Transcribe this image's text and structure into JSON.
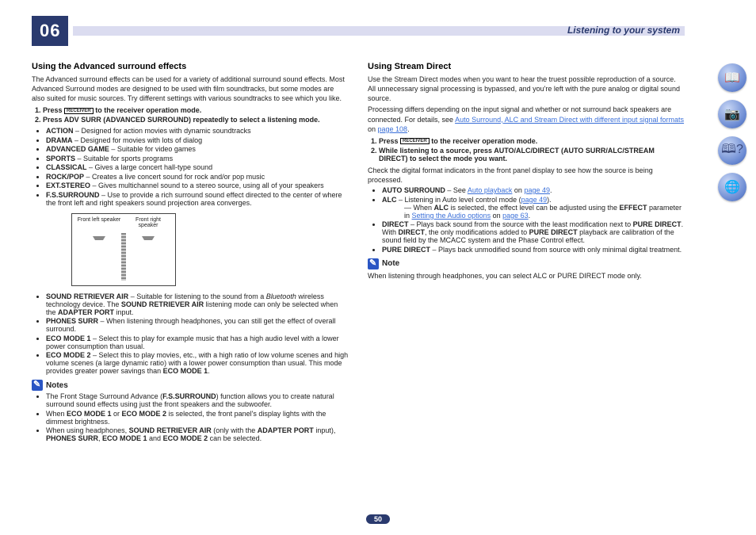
{
  "chapter": "06",
  "header_title": "Listening to your system",
  "page_number": "50",
  "left": {
    "h": "Using the Advanced surround effects",
    "intro": "The Advanced surround effects can be used for a variety of additional surround sound effects. Most Advanced Surround modes are designed to be used with film soundtracks, but some modes are also suited for music sources. Try different settings with various soundtracks to see which you like.",
    "step1_a": "Press ",
    "step1_b": " to the receiver operation mode.",
    "step2": "Press ADV SURR (ADVANCED SURROUND) repeatedly to select a listening mode.",
    "modes": [
      {
        "b": "ACTION",
        "d": " – Designed for action movies with dynamic soundtracks"
      },
      {
        "b": "DRAMA",
        "d": " – Designed for movies with lots of dialog"
      },
      {
        "b": "ADVANCED GAME",
        "d": " – Suitable for video games"
      },
      {
        "b": "SPORTS",
        "d": " – Suitable for sports programs"
      },
      {
        "b": "CLASSICAL",
        "d": " – Gives a large concert hall-type sound"
      },
      {
        "b": "ROCK/POP",
        "d": " – Creates a live concert sound for rock and/or pop music"
      },
      {
        "b": "EXT.STEREO",
        "d": " – Gives multichannel sound to a stereo source, using all of your speakers"
      },
      {
        "b": "F.S.SURROUND",
        "d": " – Use to provide a rich surround sound effect directed to the center of where the front left and right speakers sound projection area converges."
      }
    ],
    "diagram": {
      "l": "Front left speaker",
      "r": "Front right speaker"
    },
    "modes2": {
      "sr": {
        "b": "SOUND RETRIEVER AIR",
        "d1": " – Suitable for listening to the sound from a ",
        "i": "Bluetooth",
        "d2": " wireless technology device. The ",
        "b2": "SOUND RETRIEVER AIR",
        "d3": " listening mode can only be selected when the ",
        "b3": "ADAPTER PORT",
        "d4": " input."
      },
      "ph": {
        "b": "PHONES SURR",
        "d": " – When listening through headphones, you can still get the effect of overall surround."
      },
      "e1": {
        "b": "ECO MODE 1",
        "d": " – Select this to play for example music that has a high audio level with a lower power consumption than usual."
      },
      "e2": {
        "b": "ECO MODE 2",
        "d1": " – Select this to play movies, etc., with a high ratio of low volume scenes and high volume scenes (a large dynamic ratio) with a lower power consumption than usual. This mode provides greater power savings than ",
        "b2": "ECO MODE 1",
        "d2": "."
      }
    },
    "notes_h": "Notes",
    "notes": {
      "n1a": "The Front Stage Surround Advance (",
      "n1b": "F.S.SURROUND",
      "n1c": ") function allows you to create natural surround sound effects using just the front speakers and the subwoofer.",
      "n2a": "When ",
      "n2b": "ECO MODE 1",
      "n2c": " or ",
      "n2d": "ECO MODE 2",
      "n2e": " is selected, the front panel's display lights with the dimmest brightness.",
      "n3a": "When using headphones, ",
      "n3b": "SOUND RETRIEVER AIR",
      "n3c": " (only with the ",
      "n3d": "ADAPTER PORT",
      "n3e": " input), ",
      "n3f": "PHONES SURR",
      "n3g": ", ",
      "n3h": "ECO MODE 1",
      "n3i": " and ",
      "n3j": "ECO MODE 2",
      "n3k": " can be selected."
    }
  },
  "right": {
    "h": "Using Stream Direct",
    "p1": "Use the Stream Direct modes when you want to hear the truest possible reproduction of a source. All unnecessary signal processing is bypassed, and you're left with the pure analog or digital sound source.",
    "p2a": "Processing differs depending on the input signal and whether or not surround back speakers are connected. For details, see ",
    "p2link": "Auto Surround, ALC and Stream Direct with different input signal formats",
    "p2b": " on ",
    "p2page": "page 108",
    "p2c": ".",
    "step1_a": "Press ",
    "step1_b": " to the receiver operation mode.",
    "step2": "While listening to a source, press AUTO/ALC/DIRECT (AUTO SURR/ALC/STREAM DIRECT) to select the mode you want.",
    "p3": "Check the digital format indicators in the front panel display to see how the source is being processed.",
    "items": {
      "as": {
        "b": "AUTO SURROUND",
        "d": " – See ",
        "l": "Auto playback",
        "d2": " on ",
        "pg": "page 49",
        "d3": "."
      },
      "alc": {
        "b": "ALC",
        "d": " – Listening in Auto level control mode (",
        "pg": "page 49",
        "d2": ")."
      },
      "alcsub": {
        "a": "— When ",
        "b": "ALC",
        "c": " is selected, the effect level can be adjusted using the ",
        "d": "EFFECT",
        "e": " parameter in ",
        "l": "Setting the Audio options",
        "f": " on ",
        "pg": "page 63",
        "g": "."
      },
      "dir": {
        "b": "DIRECT",
        "d1": " – Plays back sound from the source with the least modification next to ",
        "b2": "PURE DIRECT",
        "d2": ". With ",
        "b3": "DIRECT",
        "d3": ", the only modifications added to ",
        "b4": "PURE DIRECT",
        "d4": " playback are calibration of the sound field by the MCACC system and the Phase Control effect."
      },
      "pd": {
        "b": "PURE DIRECT",
        "d": " – Plays back unmodified sound from source with only minimal digital treatment."
      }
    },
    "note_h": "Note",
    "note": {
      "a": "When listening through headphones, you can select ",
      "b": "ALC",
      "c": " or ",
      "d": "PURE DIRECT",
      "e": " mode only."
    }
  },
  "receiver_label": "RECEIVER"
}
